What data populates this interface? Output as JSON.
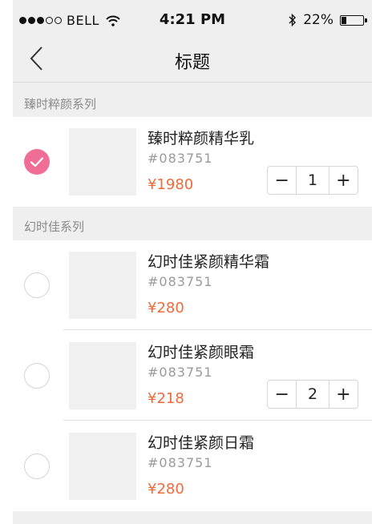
{
  "status_bar": {
    "carrier": "BELL",
    "time": "4:21 PM",
    "battery": "22%",
    "signal_bars_filled": 3,
    "signal_bars_total": 5,
    "battery_level": 0.22
  },
  "nav": {
    "title": "标题",
    "back_icon": "chevron-left-icon"
  },
  "sections": [
    {
      "title": "臻时粹颜系列",
      "products": [
        {
          "name": "臻时粹颜精华乳",
          "code": "#083751",
          "price": "¥1980",
          "selected": true,
          "quantity": "1"
        }
      ]
    },
    {
      "title": "幻时佳系列",
      "products": [
        {
          "name": "幻时佳紧颜精华霜",
          "code": "#083751",
          "price": "¥280",
          "selected": false
        },
        {
          "name": "幻时佳紧颜眼霜",
          "code": "#083751",
          "price": "¥218",
          "selected": false,
          "quantity": "2"
        },
        {
          "name": "幻时佳紧颜日霜",
          "code": "#083751",
          "price": "¥280",
          "selected": false
        }
      ]
    }
  ],
  "stepper": {
    "minus": "−",
    "plus": "+"
  },
  "colors": {
    "accent_pink": "#f06e96",
    "price_orange": "#f26a3a",
    "background": "#efefef"
  }
}
